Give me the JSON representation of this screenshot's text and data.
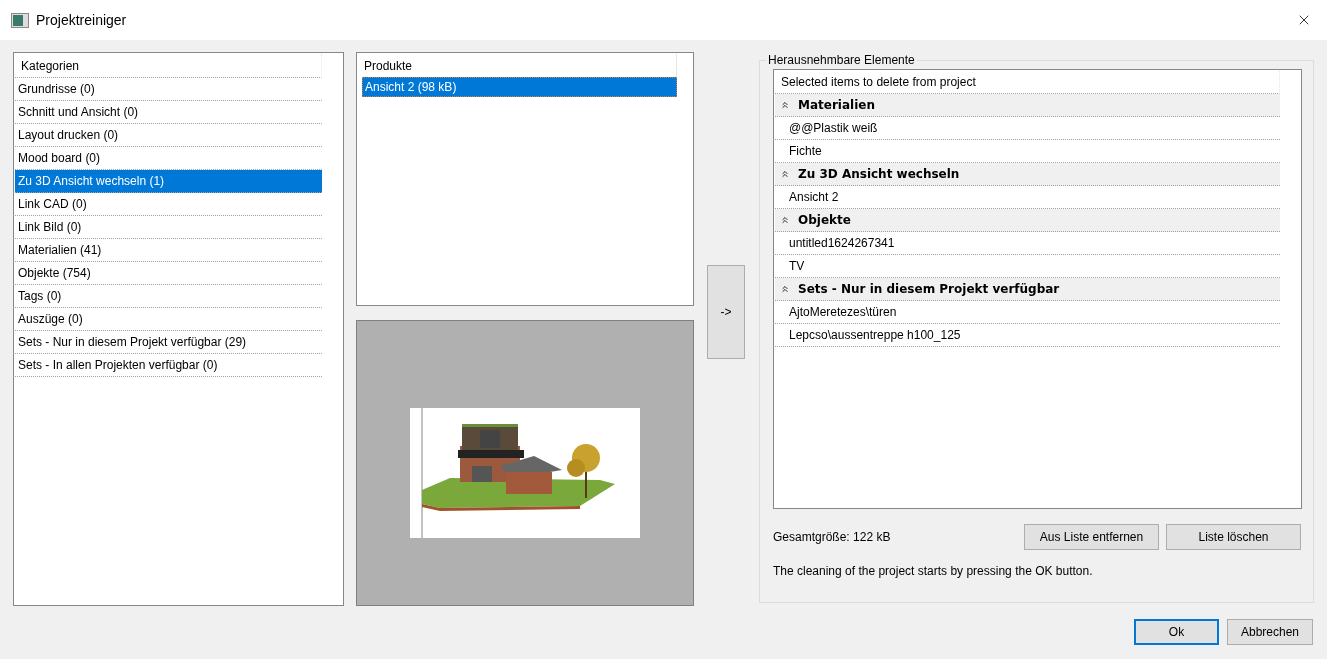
{
  "window": {
    "title": "Projektreiniger"
  },
  "categories": {
    "header": "Kategorien",
    "items": [
      {
        "label": "Grundrisse (0)",
        "selected": false
      },
      {
        "label": "Schnitt und Ansicht (0)",
        "selected": false
      },
      {
        "label": "Layout drucken (0)",
        "selected": false
      },
      {
        "label": "Mood board (0)",
        "selected": false
      },
      {
        "label": "Zu 3D Ansicht wechseln (1)",
        "selected": true
      },
      {
        "label": "Link CAD (0)",
        "selected": false
      },
      {
        "label": "Link Bild (0)",
        "selected": false
      },
      {
        "label": "Materialien (41)",
        "selected": false
      },
      {
        "label": "Objekte (754)",
        "selected": false
      },
      {
        "label": "Tags (0)",
        "selected": false
      },
      {
        "label": "Auszüge (0)",
        "selected": false
      },
      {
        "label": "Sets - Nur in diesem Projekt verfügbar (29)",
        "selected": false
      },
      {
        "label": "Sets - In allen Projekten verfügbar (0)",
        "selected": false
      }
    ]
  },
  "products": {
    "header": "Produkte",
    "items": [
      {
        "label": "Ansicht 2 (98 kB)",
        "selected": true
      }
    ]
  },
  "transfer_button": "->",
  "removable": {
    "title": "Herausnehmbare Elemente",
    "header": "Selected items to delete from project",
    "groups": [
      {
        "title": "Materialien",
        "expanded": true,
        "items": [
          "@@Plastik weiß",
          "Fichte"
        ]
      },
      {
        "title": "Zu 3D Ansicht wechseln",
        "expanded": true,
        "items": [
          "Ansicht 2"
        ]
      },
      {
        "title": "Objekte",
        "expanded": true,
        "items": [
          "untitled1624267341",
          "TV"
        ]
      },
      {
        "title": "Sets - Nur in diesem Projekt verfügbar",
        "expanded": true,
        "items": [
          "AjtoMeretezes\\türen",
          "Lepcso\\aussentreppe h100_125"
        ]
      }
    ],
    "total_size": "Gesamtgröße: 122 kB",
    "buttons": [
      "Aus Liste entfernen",
      "Liste löschen"
    ],
    "info": "The cleaning of the project starts by pressing the OK button."
  },
  "dialog_buttons": [
    {
      "label": "Ok",
      "default": true
    },
    {
      "label": "Abbrechen",
      "default": false
    }
  ]
}
